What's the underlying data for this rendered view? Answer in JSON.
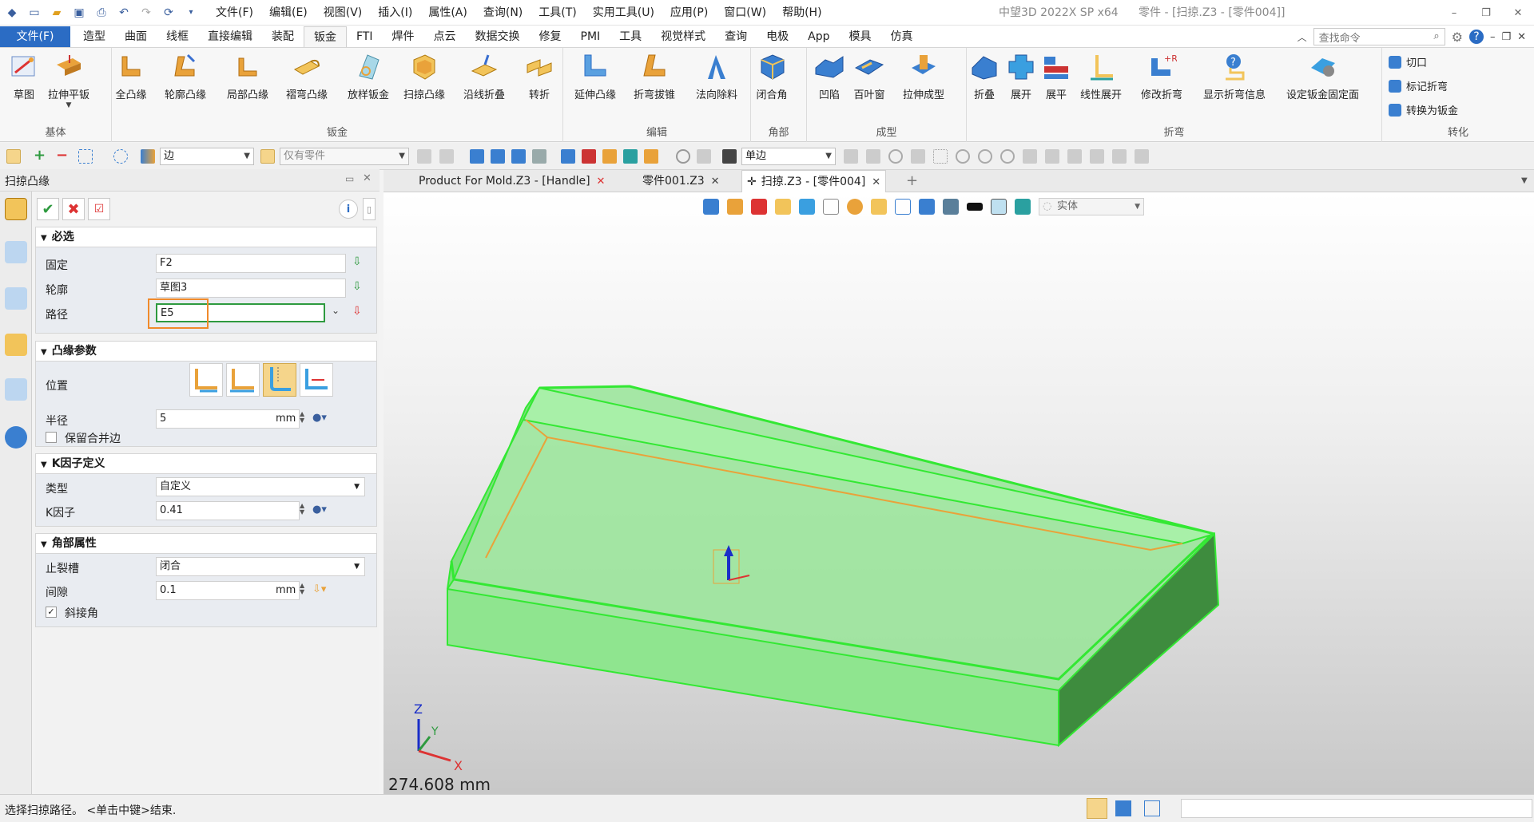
{
  "titlebar": {
    "menu": [
      "文件(F)",
      "编辑(E)",
      "视图(V)",
      "插入(I)",
      "属性(A)",
      "查询(N)",
      "工具(T)",
      "实用工具(U)",
      "应用(P)",
      "窗口(W)",
      "帮助(H)"
    ],
    "app_title": "中望3D 2022X SP x64",
    "doc_title": "零件 - [扫掠.Z3 - [零件004]]"
  },
  "ribbon": {
    "file_tab": "文件(F)",
    "tabs": [
      "造型",
      "曲面",
      "线框",
      "直接编辑",
      "装配",
      "钣金",
      "FTI",
      "焊件",
      "点云",
      "数据交换",
      "修复",
      "PMI",
      "工具",
      "视觉样式",
      "查询",
      "电极",
      "App",
      "模具",
      "仿真"
    ],
    "active_tab": "钣金",
    "search_placeholder": "查找命令",
    "groups": {
      "basic": {
        "label": "基体",
        "buttons": [
          "草图",
          "拉伸平钣"
        ]
      },
      "sheet": {
        "label": "钣金",
        "buttons": [
          "全凸缘",
          "轮廓凸缘",
          "局部凸缘",
          "褶弯凸缘",
          "放样钣金",
          "扫掠凸缘",
          "沿线折叠",
          "转折"
        ]
      },
      "edit": {
        "label": "编辑",
        "buttons": [
          "延伸凸缘",
          "折弯拔锥",
          "法向除料"
        ]
      },
      "corner": {
        "label": "角部",
        "buttons": [
          "闭合角"
        ]
      },
      "forming": {
        "label": "成型",
        "buttons": [
          "凹陷",
          "百叶窗",
          "拉伸成型"
        ]
      },
      "bend": {
        "label": "折弯",
        "buttons": [
          "折叠",
          "展开",
          "展平",
          "线性展开",
          "修改折弯",
          "显示折弯信息",
          "设定钣金固定面"
        ]
      },
      "convert": {
        "label": "转化",
        "buttons": [
          "切口",
          "标记折弯",
          "转换为钣金"
        ]
      }
    }
  },
  "select_toolbar": {
    "filter": "边",
    "scope": "仅有零件",
    "edge_mode": "单边"
  },
  "panel": {
    "title": "扫掠凸缘",
    "required": {
      "header": "必选",
      "fixed_label": "固定",
      "fixed_value": "F2",
      "profile_label": "轮廓",
      "profile_value": "草图3",
      "path_label": "路径",
      "path_value": "E5"
    },
    "flange_params": {
      "header": "凸缘参数",
      "position_label": "位置",
      "radius_label": "半径",
      "radius_value": "5",
      "radius_unit": "mm",
      "keep_merge_label": "保留合并边"
    },
    "kfactor": {
      "header": "K因子定义",
      "type_label": "类型",
      "type_value": "自定义",
      "k_label": "K因子",
      "k_value": "0.41"
    },
    "corner": {
      "header": "角部属性",
      "relief_label": "止裂槽",
      "relief_value": "闭合",
      "gap_label": "间隙",
      "gap_value": "0.1",
      "gap_unit": "mm",
      "miter_label": "斜接角"
    }
  },
  "doc_tabs": [
    {
      "label": "Product For Mold.Z3 - [Handle]"
    },
    {
      "label": "零件001.Z3"
    },
    {
      "label": "扫掠.Z3 - [零件004]"
    }
  ],
  "viewport": {
    "render_mode": "实体",
    "measure": "274.608 mm",
    "axis_x": "X",
    "axis_y": "Y",
    "axis_z": "Z"
  },
  "status": {
    "text": "选择扫掠路径。 <单击中键>结束."
  }
}
